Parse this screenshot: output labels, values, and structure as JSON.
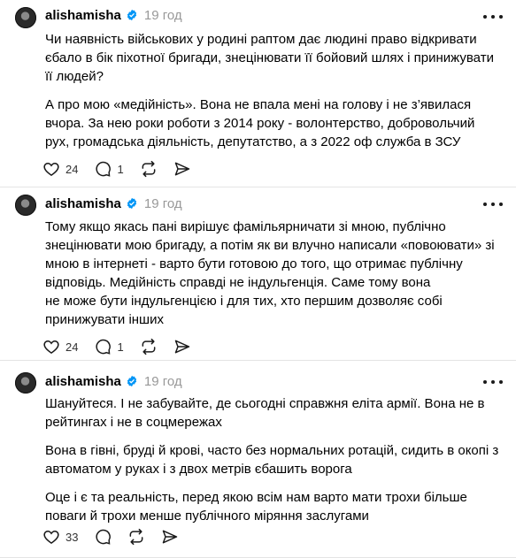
{
  "posts": [
    {
      "username": "alishamisha",
      "time": "19 год",
      "paragraphs": [
        "Чи наявність військових у родині раптом дає людині право відкривати\nєбало в бік піхотної бригади, знецінювати її бойовий шлях і принижувати\nїї людей?",
        "А про мою «медійність». Вона не впала мені на голову і не з’явилася\nвчора. За нею роки роботи з 2014 року - волонтерство, добровольчий\nрух, громадська діяльність, депутатство, а з 2022 оф служба в ЗСУ"
      ],
      "likes": "24",
      "replies": "1"
    },
    {
      "username": "alishamisha",
      "time": "19 год",
      "paragraphs": [
        "Тому якщо якась пані вирішує фамільярничати зі мною, публічно\nзнецінювати мою бригаду, а потім як ви влучно написали «повоювати» зі\nмною в інтернеті - варто бути готовою до того, що отримає публічну\nвідповідь. Медійність справді не індульгенція. Саме тому вона\nне може бути індульгенцією і для тих, хто першим дозволяє собі\nпринижувати інших"
      ],
      "likes": "24",
      "replies": "1"
    },
    {
      "username": "alishamisha",
      "time": "19 год",
      "paragraphs": [
        "Шануйтеся. І не забувайте, де сьогодні справжня еліта армії. Вона не в\nрейтингах і не в соцмережах",
        "Вона в гівні, бруді й крові, часто без нормальних ротацій, сидить в окопі з\nавтоматом у руках і з двох метрів єбашить ворога",
        "Оце і є та реальність, перед якою всім нам варто мати трохи більше\nповаги й трохи менше публічного міряння заслугами"
      ],
      "likes": "33",
      "replies": ""
    }
  ],
  "icons": {
    "verified": "verified-badge-icon",
    "like": "heart-icon",
    "reply": "comment-icon",
    "repost": "repost-icon",
    "share": "share-icon",
    "more": "more-dots-icon"
  },
  "colors": {
    "verified": "#0095f6",
    "muted": "#999999"
  }
}
